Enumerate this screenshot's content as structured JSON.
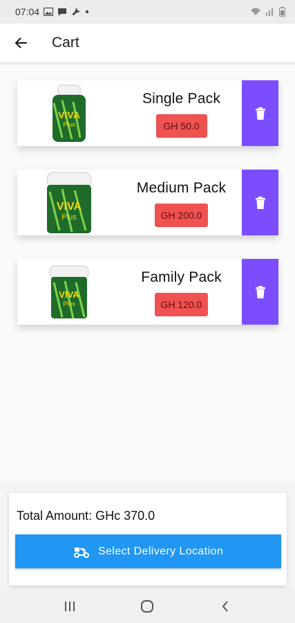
{
  "status_bar": {
    "time": "07:04",
    "left_icons": [
      "image-icon",
      "message-icon",
      "wrench-icon",
      "dot-icon"
    ],
    "right_icons": [
      "wifi-icon",
      "signal-icon",
      "battery-icon"
    ]
  },
  "app_bar": {
    "back_icon": "arrow-left-icon",
    "title": "Cart"
  },
  "cart": {
    "items": [
      {
        "name": "Single Pack",
        "price": "GH 50.0",
        "image": "viva-plus-bottle"
      },
      {
        "name": "Medium Pack",
        "price": "GH 200.0",
        "image": "viva-plus-tub"
      },
      {
        "name": "Family Pack",
        "price": "GH 120.0",
        "image": "viva-plus-jar"
      }
    ],
    "delete_icon": "trash-icon"
  },
  "summary": {
    "total_label": "Total Amount: GHc 370.0",
    "delivery_button_label": "Select Delivery Location",
    "delivery_icon": "scooter-icon"
  },
  "nav_bar": {
    "buttons": [
      "recent-apps-icon",
      "home-icon",
      "back-icon"
    ]
  },
  "colors": {
    "delete": "#7c4dff",
    "price_badge": "#f05252",
    "primary_button": "#2196f3",
    "product_green": "#1f6b2a"
  }
}
